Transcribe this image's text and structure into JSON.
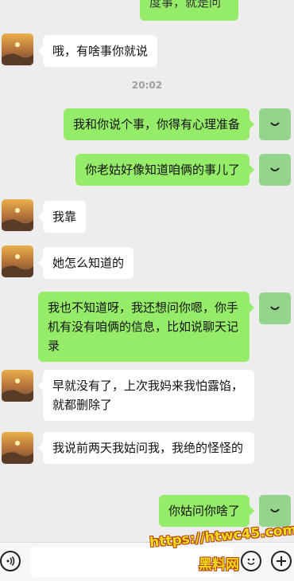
{
  "chat": {
    "top_fragment": "度事，就是问",
    "time_divider": "20:02",
    "messages": [
      {
        "side": "other",
        "text": "哦，有啥事你就说"
      },
      {
        "side": "self",
        "text": "我和你说个事，你得有心理准备"
      },
      {
        "side": "self",
        "text": "你老姑好像知道咱俩的事儿了"
      },
      {
        "side": "other",
        "text": "我靠"
      },
      {
        "side": "other",
        "text": "她怎么知道的"
      },
      {
        "side": "self",
        "text": "我也不知道呀，我还想问你嗯，你手机有没有咱俩的信息，比如说聊天记录"
      },
      {
        "side": "other",
        "text": "早就没有了，上次我妈来我怕露馅，就都删除了"
      },
      {
        "side": "other",
        "text": "我说前两天我姑问我，我绝的怪怪的"
      },
      {
        "side": "self",
        "text": "你姑问你啥了"
      }
    ]
  },
  "watermark": {
    "line1": "https://htwc45.com",
    "line2": "黑料网"
  },
  "colors": {
    "self_bubble": "#95ec69",
    "other_bubble": "#ffffff",
    "background": "#ededed"
  }
}
